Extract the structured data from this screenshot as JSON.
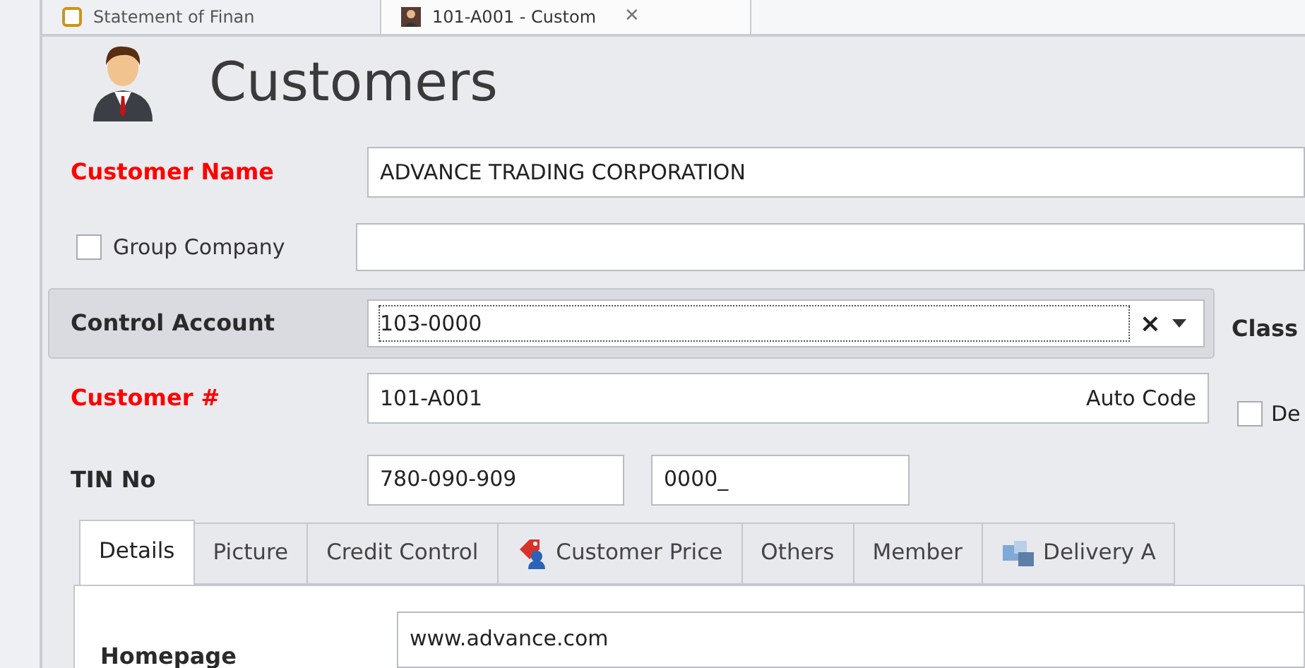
{
  "document_tabs": [
    {
      "label": "Statement of Finan",
      "selected": false
    },
    {
      "label": "101-A001 - Custom",
      "selected": true,
      "close": "✕"
    }
  ],
  "header": {
    "title": "Customers"
  },
  "customer_name": {
    "label": "Customer Name",
    "required": true,
    "value": "ADVANCE TRADING CORPORATION"
  },
  "group_company": {
    "label": "Group Company",
    "checked": false
  },
  "control_account": {
    "label": "Control Account",
    "value": "103-0000",
    "clear": "×"
  },
  "class_label": "Class",
  "customer_no": {
    "label": "Customer #",
    "required": true,
    "value": "101-A001",
    "hint": "Auto Code"
  },
  "de_checkbox": {
    "label": "De",
    "checked": false
  },
  "tin": {
    "label": "TIN No",
    "required": false,
    "value": "780-090-909",
    "branch": "0000_"
  },
  "detail_tabs": [
    {
      "label": "Details",
      "selected": true,
      "kind": "plain"
    },
    {
      "label": "Picture",
      "selected": false,
      "kind": "plain"
    },
    {
      "label": "Credit Control",
      "selected": false,
      "kind": "plain"
    },
    {
      "label": "Customer Price",
      "selected": false,
      "kind": "price"
    },
    {
      "label": "Others",
      "selected": false,
      "kind": "plain"
    },
    {
      "label": "Member",
      "selected": false,
      "kind": "plain"
    },
    {
      "label": "Delivery A",
      "selected": false,
      "kind": "delivery"
    }
  ],
  "homepage": {
    "label": "Homepage",
    "value": "www.advance.com"
  }
}
